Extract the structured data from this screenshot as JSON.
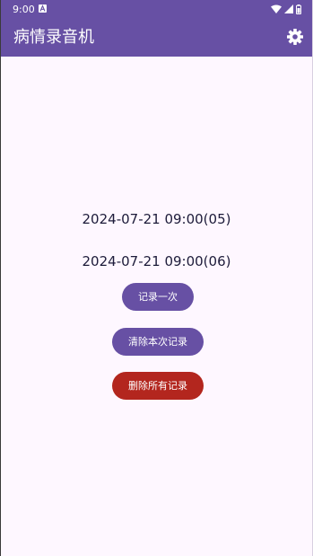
{
  "status_bar": {
    "time": "9:00",
    "icons": [
      "a-notification-icon",
      "wifi-icon",
      "cellular-signal-icon",
      "battery-icon"
    ]
  },
  "app_bar": {
    "title": "病情录音机",
    "settings_icon": "gear-icon",
    "background": "#6750a4"
  },
  "records": [
    "2024-07-21 09:00(05)",
    "2024-07-21 09:00(06)"
  ],
  "buttons": {
    "record_once": "记录一次",
    "clear_current": "清除本次记录",
    "delete_all": "删除所有记录"
  },
  "colors": {
    "primary": "#6750a4",
    "danger": "#b3261e",
    "background": "#fef7ff",
    "text": "#1d1b3a"
  }
}
